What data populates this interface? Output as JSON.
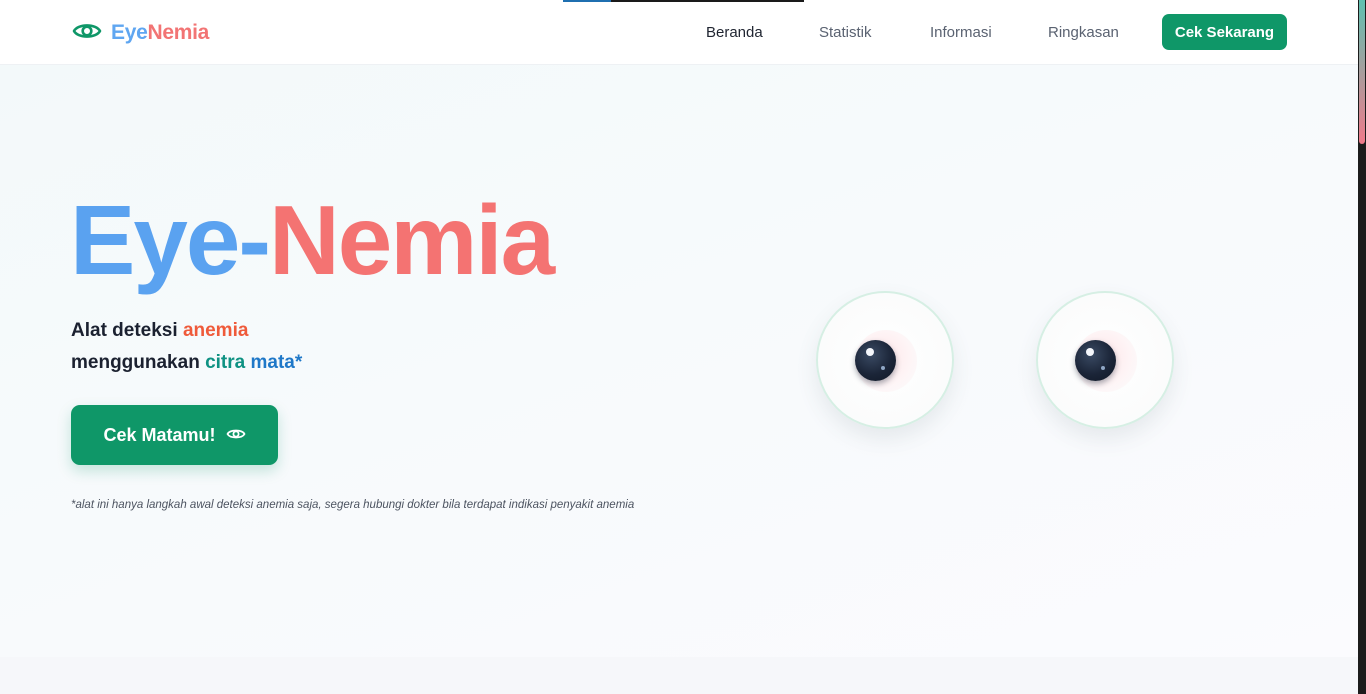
{
  "brand": {
    "part_a": "Eye",
    "part_b": "Nemia",
    "icon": "eye-icon"
  },
  "nav": {
    "items": [
      {
        "label": "Beranda",
        "active": true
      },
      {
        "label": "Statistik",
        "active": false
      },
      {
        "label": "Informasi",
        "active": false
      },
      {
        "label": "Ringkasan",
        "active": false
      }
    ],
    "cta_label": "Cek Sekarang"
  },
  "hero": {
    "title_a": "Eye-",
    "title_b": "Nemia",
    "subtitle": {
      "line1_prefix": "Alat deteksi ",
      "line1_highlight": "anemia",
      "line2_prefix": "menggunakan ",
      "line2_highlight_a": "citra",
      "line2_space": " ",
      "line2_highlight_b": "mata*"
    },
    "cta_label": "Cek Matamu!",
    "cta_icon": "eye-icon",
    "disclaimer": "*alat ini hanya langkah awal deteksi anemia saja, segera hubungi dokter bila terdapat indikasi penyakit anemia"
  },
  "colors": {
    "primary_green": "#0f9768",
    "brand_blue": "#5aa2f0",
    "brand_red": "#f47372",
    "anemia_orange": "#ef5a3a",
    "citra_teal": "#0f9283",
    "mata_blue": "#1f78c8"
  }
}
